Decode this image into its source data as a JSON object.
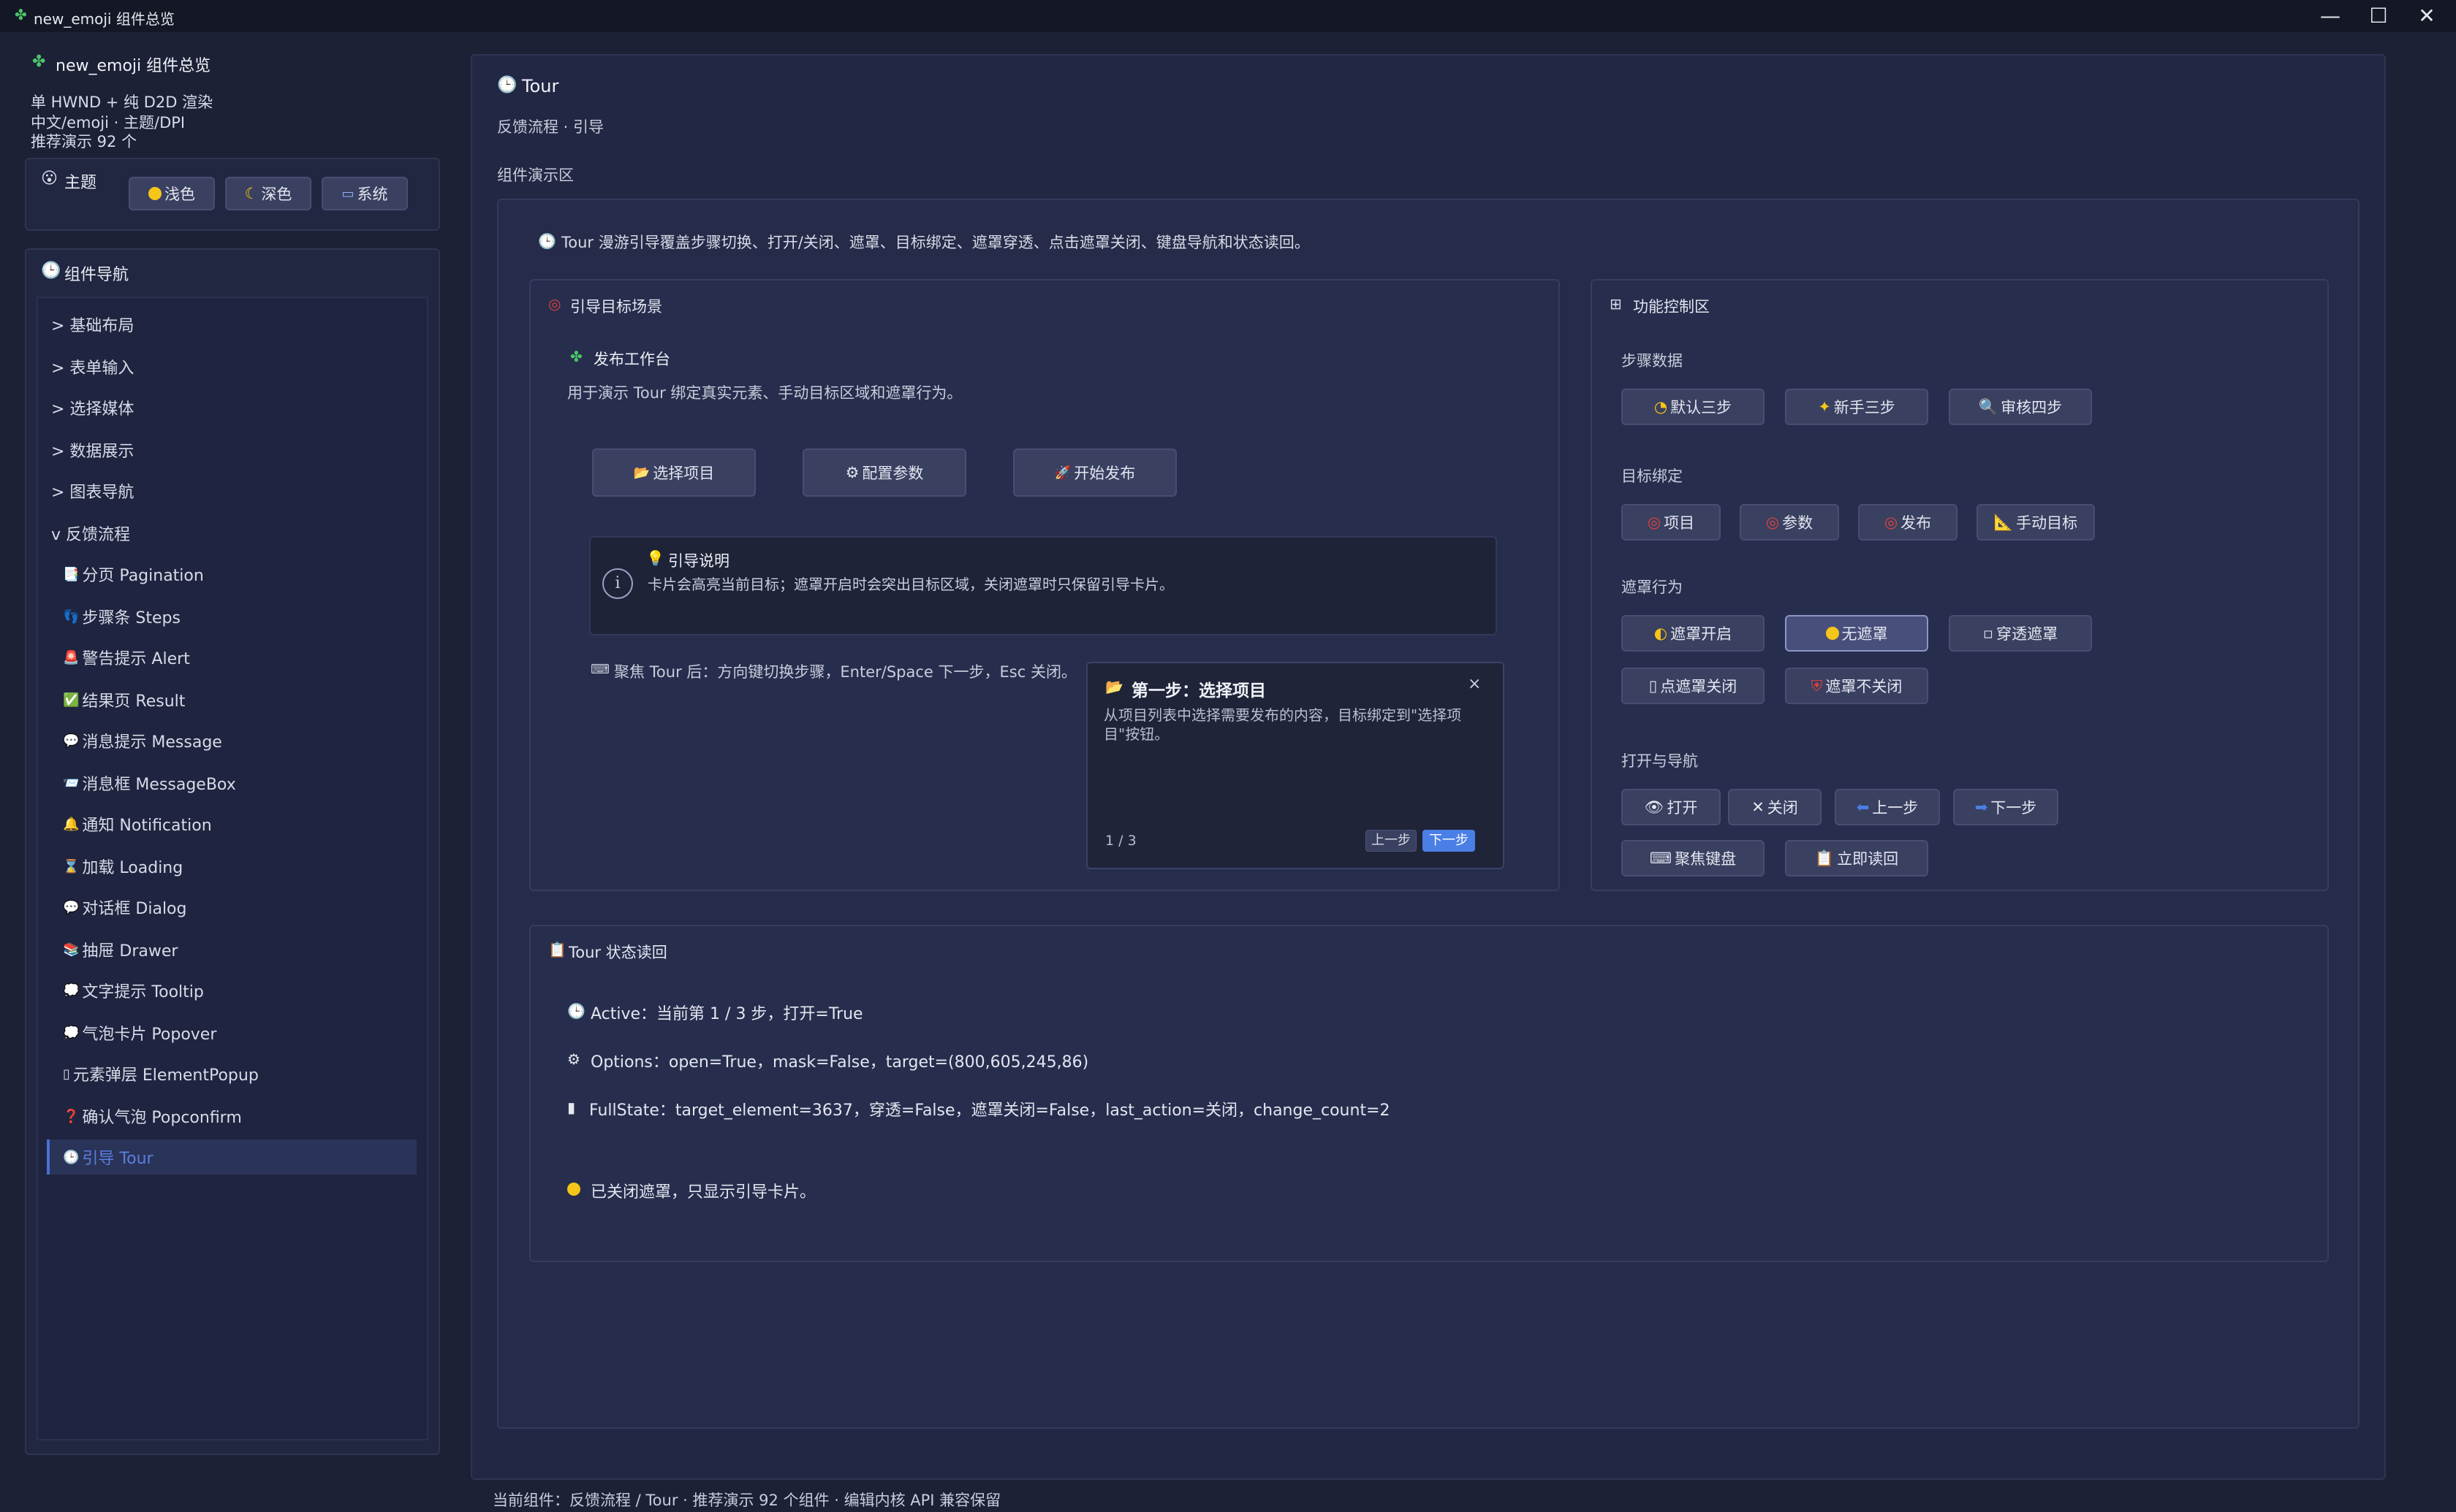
{
  "window": {
    "title": "new_emoji 组件总览",
    "minimize": "—",
    "maximize": "☐",
    "close": "✕"
  },
  "sidebar": {
    "app_title": "new_emoji 组件总览",
    "info": [
      "单 HWND + 纯 D2D 渲染",
      "中文/emoji · 主题/DPI",
      "推荐演示 92 个"
    ],
    "theme": {
      "title": "主题",
      "buttons": [
        "浅色",
        "深色",
        "系统"
      ]
    },
    "nav": {
      "title": "组件导航",
      "groups": [
        "> 基础布局",
        "> 表单输入",
        "> 选择媒体",
        "> 数据展示",
        "> 图表导航",
        "v 反馈流程"
      ],
      "items": [
        "分页 Pagination",
        "步骤条 Steps",
        "警告提示 Alert",
        "结果页 Result",
        "消息提示 Message",
        "消息框 MessageBox",
        "通知 Notification",
        "加载 Loading",
        "对话框 Dialog",
        "抽屉 Drawer",
        "文字提示 Tooltip",
        "气泡卡片 Popover",
        "元素弹层 ElementPopup",
        "确认气泡 Popconfirm",
        "引导 Tour"
      ],
      "item_icons": [
        "📑",
        "👣",
        "🚨",
        "✅",
        "💬",
        "📨",
        "🔔",
        "⌛",
        "💬",
        "📚",
        "💭",
        "💭",
        "▯",
        "❓",
        "🕒"
      ]
    }
  },
  "main": {
    "title": "Tour",
    "subtitle": "反馈流程 · 引导",
    "demo_label": "组件演示区",
    "intro": "Tour 漫游引导覆盖步骤切换、打开/关闭、遮罩、目标绑定、遮罩穿透、点击遮罩关闭、键盘导航和状态读回。",
    "scene": {
      "title": "引导目标场景",
      "workspace_title": "发布工作台",
      "workspace_desc": "用于演示 Tour 绑定真实元素、手动目标区域和遮罩行为。",
      "buttons": [
        "选择项目",
        "配置参数",
        "开始发布"
      ],
      "button_icons": [
        "📂",
        "⚙",
        "🚀"
      ],
      "notice_title": "引导说明",
      "notice_text": "卡片会高亮当前目标；遮罩开启时会突出目标区域，关闭遮罩时只保留引导卡片。",
      "keyboard_hint": "聚焦 Tour 后：方向键切换步骤，Enter/Space 下一步，Esc 关闭。",
      "tour_card": {
        "title": "第一步：选择项目",
        "body": "从项目列表中选择需要发布的内容，目标绑定到\"选择项目\"按钮。",
        "step": "1 / 3",
        "prev": "上一步",
        "next": "下一步",
        "close": "×"
      }
    },
    "controls": {
      "title": "功能控制区",
      "step_data_label": "步骤数据",
      "step_data": [
        "默认三步",
        "新手三步",
        "审核四步"
      ],
      "target_label": "目标绑定",
      "targets": [
        "项目",
        "参数",
        "发布",
        "手动目标"
      ],
      "mask_label": "遮罩行为",
      "mask_row1": [
        "遮罩开启",
        "无遮罩",
        "穿透遮罩"
      ],
      "mask_row2": [
        "点遮罩关闭",
        "遮罩不关闭"
      ],
      "nav_label": "打开与导航",
      "nav_row1": [
        "打开",
        "关闭",
        "上一步",
        "下一步"
      ],
      "nav_row2": [
        "聚焦键盘",
        "立即读回"
      ]
    },
    "status": {
      "title": "Tour 状态读回",
      "active": "Active：当前第 1 / 3 步，打开=True",
      "options": "Options：open=True，mask=False，target=(800,605,245,86)",
      "full_state": "FullState：target_element=3637，穿透=False，遮罩关闭=False，last_action=关闭，change_count=2",
      "note": "已关闭遮罩，只显示引导卡片。"
    }
  },
  "footer": {
    "text": "当前组件：反馈流程 / Tour · 推荐演示 92 个组件 · 编辑内核 API 兼容保留"
  },
  "colors": {
    "background": "#1c2136",
    "panel": "#212741",
    "button": "#3a4060",
    "accent": "#4c6fd8",
    "selected_text": "#5b7fe0"
  }
}
